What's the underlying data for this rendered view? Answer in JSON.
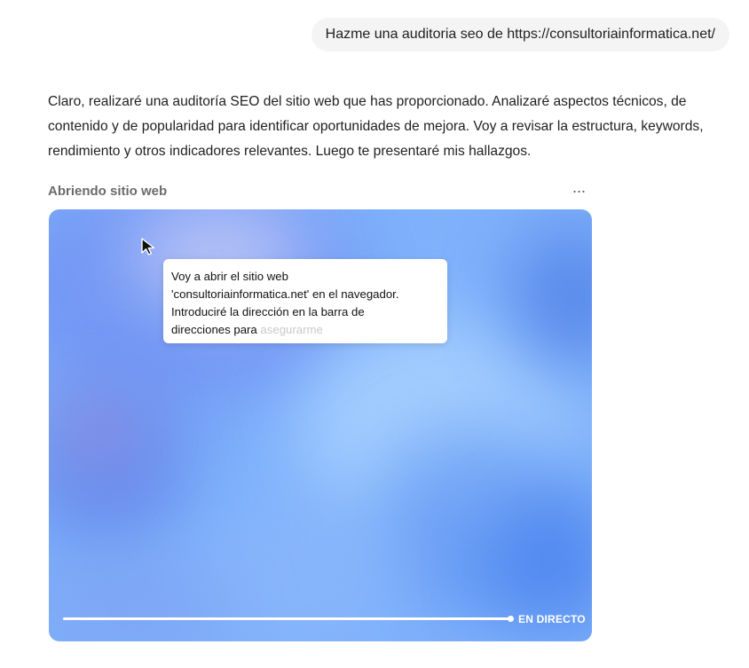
{
  "user_message": "Hazme una auditoria seo de https://consultoriainformatica.net/",
  "assistant": {
    "text": "Claro, realizaré una auditoría SEO del sitio web que has proporcionado. Analizaré aspectos técnicos, de contenido y de popularidad para identificar oportunidades de mejora. Voy a revisar la estructura, keywords, rendimiento y otros indicadores relevantes. Luego te presentaré mis hallazgos."
  },
  "step": {
    "title": "Abriendo sitio web",
    "more_icon": "more-horizontal-icon",
    "more_label": "···"
  },
  "live_view": {
    "tooltip": {
      "lines": [
        "Voy a abrir el sitio web",
        "'consultoriainformatica.net' en el navegador.",
        "Introduciré la dirección en la barra de",
        "direcciones para"
      ],
      "faded_text": " asegurarme"
    },
    "cursor_icon": "mouse-pointer-icon",
    "progress_fraction": 1.0,
    "live_label": "EN DIRECTO"
  }
}
